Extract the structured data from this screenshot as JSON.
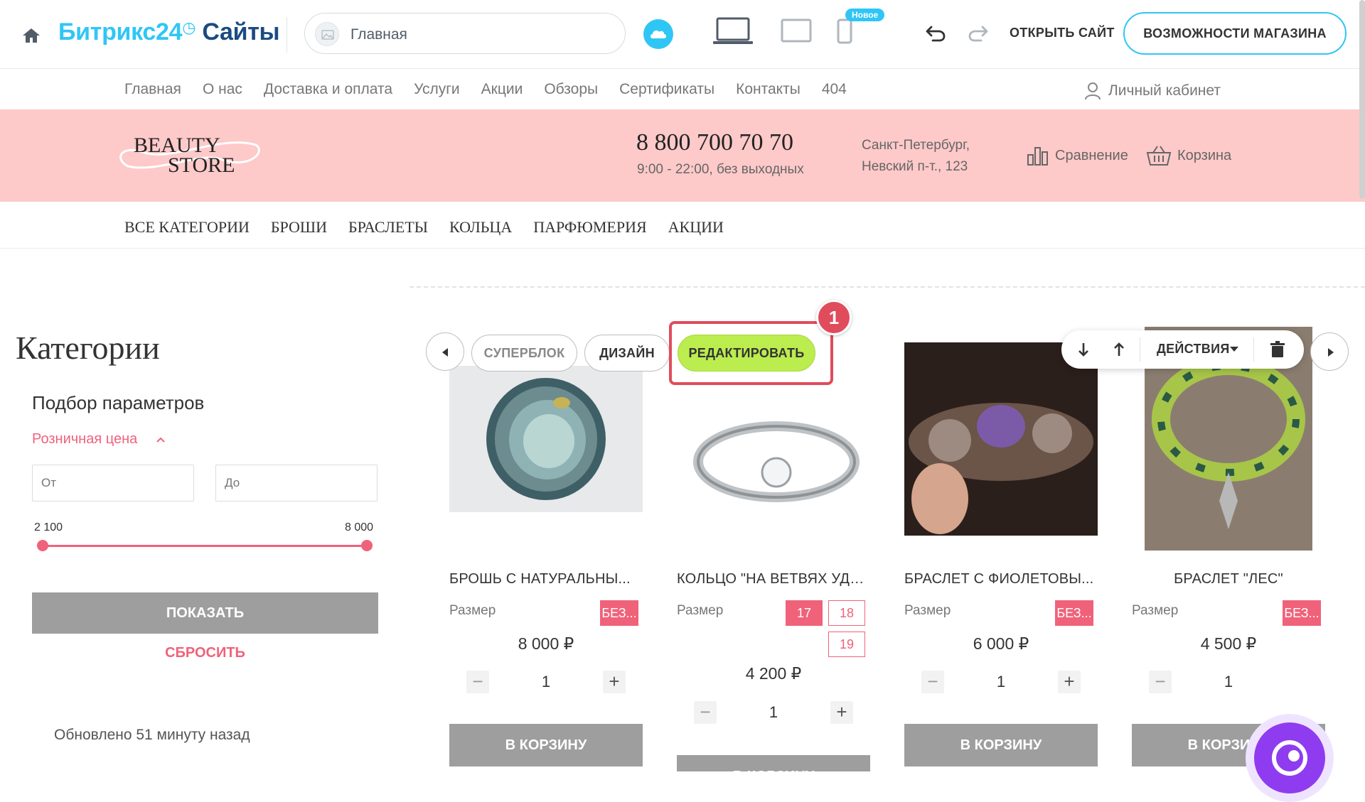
{
  "toolbar": {
    "brand_part1": "Битрикс24",
    "brand_part2": "Сайты",
    "page_select_label": "Главная",
    "new_badge": "Новое",
    "open_site": "ОТКРЫТЬ САЙТ",
    "shop_features": "ВОЗМОЖНОСТИ МАГАЗИНА",
    "accent_color": "#2fc6f6"
  },
  "site": {
    "top_nav": [
      "Главная",
      "О нас",
      "Доставка и оплата",
      "Услуги",
      "Акции",
      "Обзоры",
      "Сертификаты",
      "Контакты",
      "404"
    ],
    "account": "Личный кабинет",
    "logo_line1": "BEAUTY",
    "logo_line2": "STORE",
    "phone": "8 800 700 70 70",
    "hours": "9:00 - 22:00, без выходных",
    "address_line1": "Санкт-Петербург,",
    "address_line2": "Невский п-т., 123",
    "compare": "Сравнение",
    "cart": "Корзина",
    "header_color": "#fec9c9",
    "category_nav": [
      "ВСЕ КАТЕГОРИИ",
      "БРОШИ",
      "БРАСЛЕТЫ",
      "КОЛЬЦА",
      "ПАРФЮМЕРИЯ",
      "АКЦИИ"
    ]
  },
  "sidebar": {
    "title": "Категории",
    "filter_title": "Подбор параметров",
    "price_label": "Розничная цена",
    "from_placeholder": "От",
    "to_placeholder": "До",
    "range_min": "2 100",
    "range_max": "8 000",
    "show_button": "ПОКАЗАТЬ",
    "reset_button": "СБРОСИТЬ",
    "updated": "Обновлено 51 минуту назад"
  },
  "editor": {
    "superblock": "СУПЕРБЛОК",
    "design": "ДИЗАЙН",
    "edit": "РЕДАКТИРОВАТЬ",
    "step_number": "1",
    "actions": "ДЕЙСТВИЯ",
    "edit_color": "#bbed4e",
    "highlight_color": "#e04c5c"
  },
  "products": [
    {
      "name": "БРОШЬ С НАТУРАЛЬНЫ...",
      "size_label": "Размер",
      "sizes": [
        "БЕЗ..."
      ],
      "price": "8 000 ₽",
      "qty": "1",
      "cart": "В КОРЗИНУ"
    },
    {
      "name": "КОЛЬЦО \"НА ВЕТВЯХ УДА...",
      "size_label": "Размер",
      "sizes": [
        "17",
        "18",
        "19"
      ],
      "price": "4 200 ₽",
      "qty": "1",
      "cart": "В КОРЗИНУ"
    },
    {
      "name": "БРАСЛЕТ С ФИОЛЕТОВЫ...",
      "size_label": "Размер",
      "sizes": [
        "БЕЗ..."
      ],
      "price": "6 000 ₽",
      "qty": "1",
      "cart": "В КОРЗИНУ"
    },
    {
      "name": "БРАСЛЕТ \"ЛЕС\"",
      "size_label": "Размер",
      "sizes": [
        "БЕЗ..."
      ],
      "price": "4 500 ₽",
      "qty": "1",
      "cart": "В КОРЗИНУ"
    }
  ],
  "icons": {
    "home": "home-icon",
    "cloud": "cloud-icon",
    "laptop": "laptop-icon",
    "tablet": "tablet-icon",
    "phone": "phone-icon",
    "undo": "undo-icon",
    "redo": "redo-icon",
    "user": "user-icon",
    "compare": "bar-chart-icon",
    "cart": "basket-icon",
    "assistant": "assistant-icon"
  }
}
